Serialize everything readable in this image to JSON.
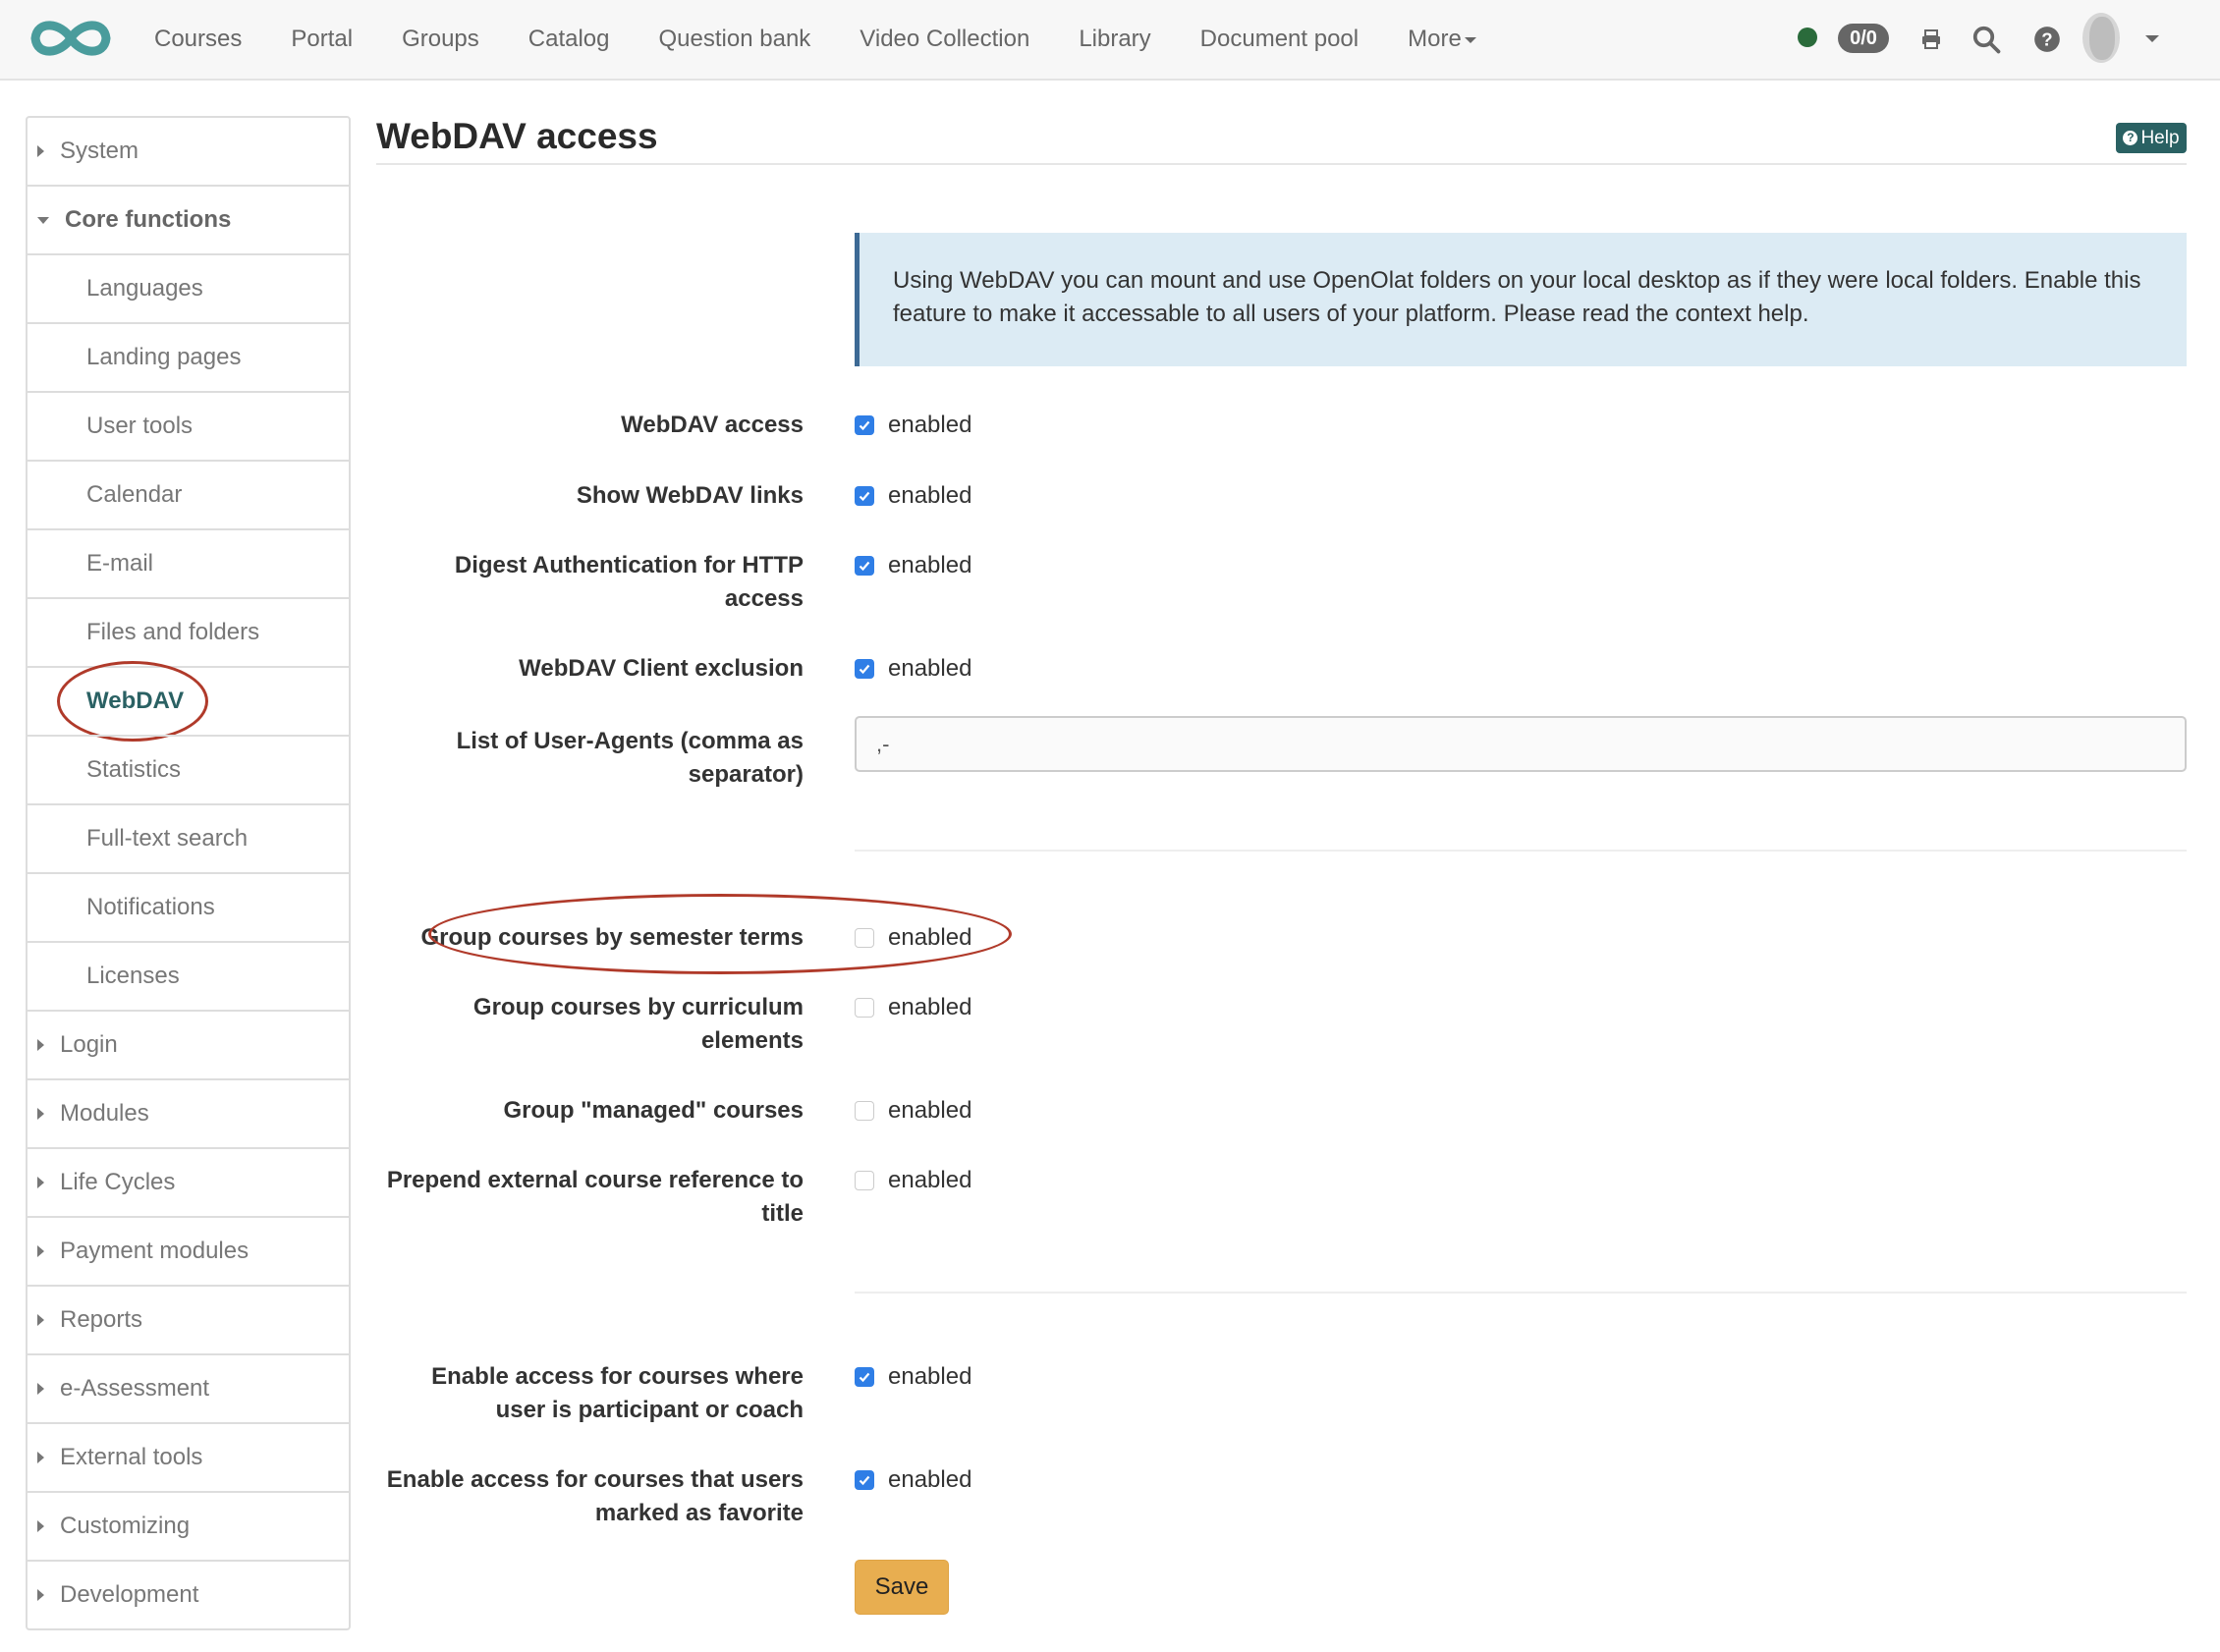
{
  "topbar": {
    "logo": "openolat-infinity-logo",
    "nav": [
      {
        "label": "Courses"
      },
      {
        "label": "Portal"
      },
      {
        "label": "Groups"
      },
      {
        "label": "Catalog"
      },
      {
        "label": "Question bank"
      },
      {
        "label": "Video Collection"
      },
      {
        "label": "Library"
      },
      {
        "label": "Document pool"
      },
      {
        "label": "More"
      }
    ],
    "status_color": "#2a6b3b",
    "badge": "0/0",
    "icons": [
      "print-icon",
      "search-icon",
      "help-icon",
      "avatar",
      "chevron-down-icon"
    ]
  },
  "sidebar": {
    "items": [
      {
        "label": "System",
        "type": "collapsed"
      },
      {
        "label": "Core functions",
        "type": "expanded"
      },
      {
        "label": "Languages",
        "type": "child"
      },
      {
        "label": "Landing pages",
        "type": "child"
      },
      {
        "label": "User tools",
        "type": "child"
      },
      {
        "label": "Calendar",
        "type": "child"
      },
      {
        "label": "E-mail",
        "type": "child"
      },
      {
        "label": "Files and folders",
        "type": "child"
      },
      {
        "label": "WebDAV",
        "type": "child-active"
      },
      {
        "label": "Statistics",
        "type": "child"
      },
      {
        "label": "Full-text search",
        "type": "child"
      },
      {
        "label": "Notifications",
        "type": "child"
      },
      {
        "label": "Licenses",
        "type": "child"
      },
      {
        "label": "Login",
        "type": "collapsed"
      },
      {
        "label": "Modules",
        "type": "collapsed"
      },
      {
        "label": "Life Cycles",
        "type": "collapsed"
      },
      {
        "label": "Payment modules",
        "type": "collapsed"
      },
      {
        "label": "Reports",
        "type": "collapsed"
      },
      {
        "label": "e-Assessment",
        "type": "collapsed"
      },
      {
        "label": "External tools",
        "type": "collapsed"
      },
      {
        "label": "Customizing",
        "type": "collapsed"
      },
      {
        "label": "Development",
        "type": "collapsed"
      }
    ]
  },
  "main": {
    "title": "WebDAV access",
    "help_label": "Help",
    "info": "Using WebDAV you can mount and use OpenOlat folders on your local desktop as if they were local folders. Enable this feature to make it accessable to all users of your platform. Please read the context help.",
    "fields": [
      {
        "label": "WebDAV access",
        "option": "enabled",
        "checked": true
      },
      {
        "label": "Show WebDAV links",
        "option": "enabled",
        "checked": true
      },
      {
        "label": "Digest Authentication for HTTP access",
        "option": "enabled",
        "checked": true
      },
      {
        "label": "WebDAV Client exclusion",
        "option": "enabled",
        "checked": true
      },
      {
        "label": "List of User-Agents (comma as separator)",
        "value": ",-"
      },
      {
        "label": "Group courses by semester terms",
        "option": "enabled",
        "checked": false
      },
      {
        "label": "Group courses by curriculum elements",
        "option": "enabled",
        "checked": false
      },
      {
        "label": "Group \"managed\" courses",
        "option": "enabled",
        "checked": false
      },
      {
        "label": "Prepend external course reference to title",
        "option": "enabled",
        "checked": false
      },
      {
        "label": "Enable access for courses where user is participant or coach",
        "option": "enabled",
        "checked": true
      },
      {
        "label": "Enable access for courses that users marked as favorite",
        "option": "enabled",
        "checked": true
      }
    ],
    "save_label": "Save"
  },
  "annotations": {
    "color": "#b03a2a",
    "highlighted": [
      "WebDAV",
      "Group courses by semester terms"
    ]
  }
}
